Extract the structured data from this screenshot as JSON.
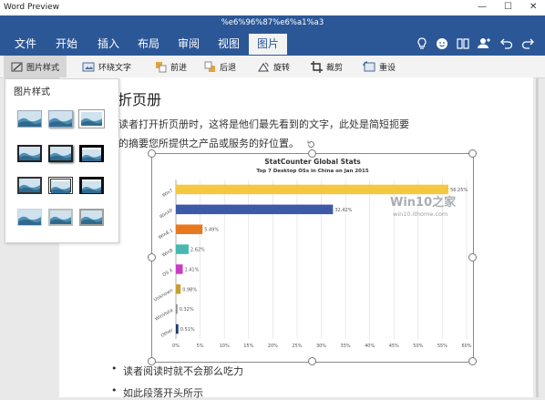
{
  "window": {
    "title": "Word Preview",
    "minimize": "—",
    "maximize": "☐",
    "close": "✕"
  },
  "document_title": "%e6%96%87%e6%a1%a3",
  "ribbon_tabs": [
    "文件",
    "开始",
    "插入",
    "布局",
    "审阅",
    "视图",
    "图片"
  ],
  "active_tab": "图片",
  "ribbon_icons": [
    "lightbulb-icon",
    "smiley-icon",
    "book-icon",
    "person-add-icon",
    "undo-icon",
    "redo-icon"
  ],
  "toolbar": {
    "picture_styles": "图片样式",
    "wrap_text": "环绕文字",
    "bring_forward": "前进",
    "send_backward": "后退",
    "rotate": "旋转",
    "crop": "裁剪",
    "reset": "重设"
  },
  "gallery": {
    "title": "图片样式",
    "styles": [
      "plain",
      "soft-shadow",
      "thin-border",
      "thick-black-border",
      "black-border-shadow",
      "heavy-black-frame",
      "dark-border",
      "double-border",
      "black-frame",
      "light",
      "gray-frame",
      "gray-matte"
    ]
  },
  "document": {
    "heading": "折页册",
    "paragraph_line1": "读者打开折页册时，这将是他们最先看到的文字，此处是简短扼要",
    "paragraph_line2": "的摘要您所提供之产品或服务的好位置。",
    "bullets": [
      "读者阅读时就不会那么吃力",
      "如此段落开头所示"
    ]
  },
  "watermark": {
    "main": "Win10之家",
    "sub": "win10.ithome.com"
  },
  "chart_data": {
    "type": "bar",
    "orientation": "horizontal",
    "title": "StatCounter Global Stats",
    "subtitle": "Top 7 Desktop OSs in China on Jan 2015",
    "categories": [
      "Win7",
      "WinXP",
      "Win8.1",
      "Win8",
      "OS X",
      "Unknown",
      "WinVista",
      "Other"
    ],
    "values": [
      56.25,
      32.42,
      5.49,
      2.62,
      1.41,
      0.98,
      0.32,
      0.51
    ],
    "value_labels": [
      "56.25%",
      "32.42%",
      "5.49%",
      "2.62%",
      "1.41%",
      "0.98%",
      "0.32%",
      "0.51%"
    ],
    "colors": [
      "#f5c842",
      "#3d5aa8",
      "#e8781e",
      "#46b8b0",
      "#c83cc8",
      "#c8a032",
      "#8a8a8a",
      "#1f3a6e"
    ],
    "xlim": [
      0,
      60
    ],
    "xticks": [
      "0%",
      "5%",
      "10%",
      "15%",
      "20%",
      "25%",
      "30%",
      "35%",
      "40%",
      "45%",
      "50%",
      "55%",
      "60%"
    ],
    "grid": true
  }
}
